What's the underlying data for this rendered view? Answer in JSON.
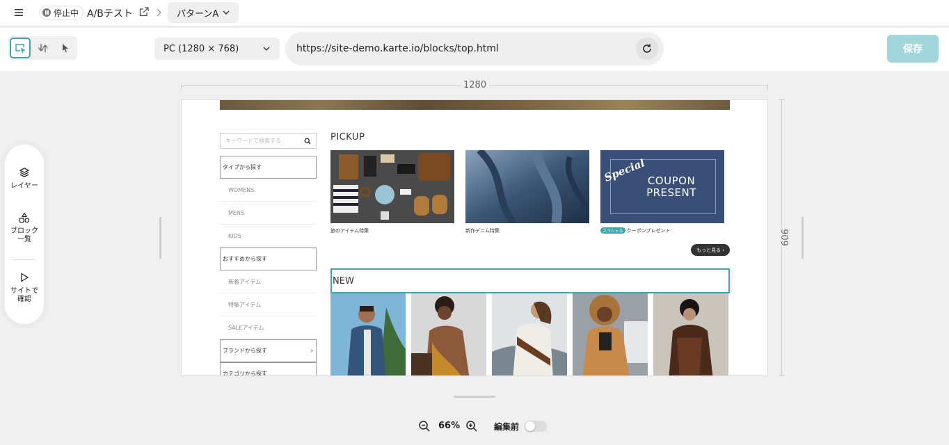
{
  "topbar": {
    "status": "停止中",
    "test_title": "A/Bテスト",
    "pattern": "パターンA"
  },
  "toolbar": {
    "device": "PC (1280 × 768)",
    "url": "https://site-demo.karte.io/blocks/top.html",
    "save_label": "保存"
  },
  "ruler": {
    "width_label": "1280",
    "height_label": "909"
  },
  "side_panel": {
    "layers": "レイヤー",
    "blocks_line1": "ブロック",
    "blocks_line2": "一覧",
    "preview_line1": "サイトで",
    "preview_line2": "確認"
  },
  "site": {
    "search_placeholder": "キーワードで検索する",
    "nav": [
      {
        "label": "タイプから探す",
        "head": true
      },
      {
        "label": "WOMENS"
      },
      {
        "label": "MENS"
      },
      {
        "label": "KIDS"
      },
      {
        "label": "おすすめから探す",
        "head": true
      },
      {
        "label": "新着アイテム"
      },
      {
        "label": "特集アイテム"
      },
      {
        "label": "SALEアイテム"
      },
      {
        "label": "ブランドから探す",
        "head": true,
        "arrow": "›"
      },
      {
        "label": "カテゴリから探す",
        "head": true
      }
    ],
    "pickup_title": "PICKUP",
    "pickup": [
      {
        "caption": "旅のアイテム特集"
      },
      {
        "caption": "新作デニム特集"
      },
      {
        "caption": "クーポンプレゼント",
        "badge": "スペシャル",
        "special": "Special",
        "coupon_line1": "COUPON",
        "coupon_line2": "PRESENT"
      }
    ],
    "more_label": "もっと見る",
    "new_title": "NEW"
  },
  "zoom": {
    "value": "66%",
    "before_label": "編集前"
  },
  "colors": {
    "accent": "#3aa6ad",
    "save_disabled": "#a3d6da",
    "coupon_bg": "#3a4f78"
  }
}
